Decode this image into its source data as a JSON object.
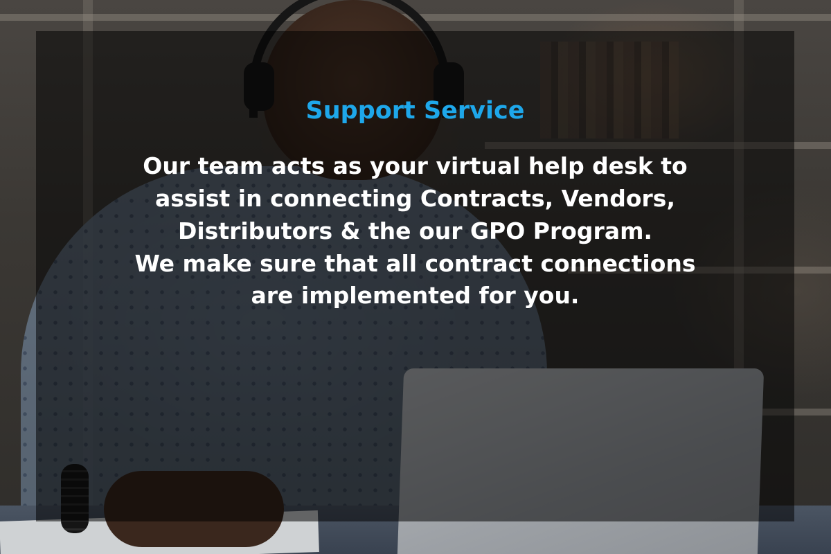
{
  "banner": {
    "title": "Support Service",
    "description_lines": [
      "Our team acts as your virtual help desk to",
      "assist in connecting Contracts, Vendors,",
      "Distributors & the our GPO Program.",
      "We make sure that all contract connections",
      "are implemented for you."
    ],
    "title_color": "#1ea7ea",
    "text_color": "#ffffff"
  }
}
